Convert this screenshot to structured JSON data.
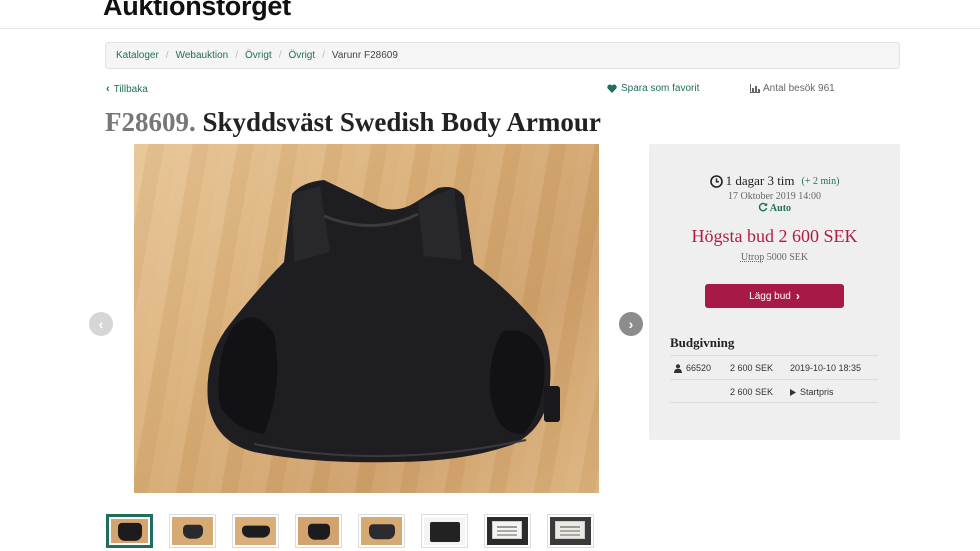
{
  "site": {
    "logo": "Auktionstorget"
  },
  "breadcrumb": {
    "items": [
      "Kataloger",
      "Webauktion",
      "Övrigt",
      "Övrigt",
      "Varunr F28609"
    ]
  },
  "nav": {
    "back_label": "Tillbaka",
    "favorite_label": "Spara som favorit",
    "visits_label": "Antal besök 961"
  },
  "item": {
    "id": "F28609.",
    "name": "Skyddsväst Swedish Body Armour"
  },
  "bidding": {
    "time_left": "1 dagar 3 tim",
    "time_extra": "(+ 2 min)",
    "end_date": "17 Oktober 2019 14:00",
    "auto_label": "Auto",
    "highest_bid": "Högsta bud 2 600 SEK",
    "reserve_label": "Utrop",
    "reserve_value": "5000 SEK",
    "bid_button_label": "Lägg bud",
    "history_title": "Budgivning",
    "history": [
      {
        "bidder": "66520",
        "amount": "2 600 SEK",
        "info": "2019-10-10 18:35"
      },
      {
        "bidder": "",
        "amount": "2 600 SEK",
        "info": "Startpris"
      }
    ]
  },
  "icons": {
    "back": "chevron-left-icon",
    "favorite": "heart-icon",
    "visits": "bar-chart-icon",
    "timer": "clock-icon",
    "auto": "refresh-icon",
    "bid": "chevron-right-icon",
    "bidder": "user-icon",
    "start": "play-icon"
  },
  "colors": {
    "accent": "#1f6f5c",
    "bid_red": "#b01c43",
    "button": "#a81a46",
    "panel": "#efefef"
  },
  "gallery": {
    "thumb_count": 8,
    "active_index": 0
  }
}
